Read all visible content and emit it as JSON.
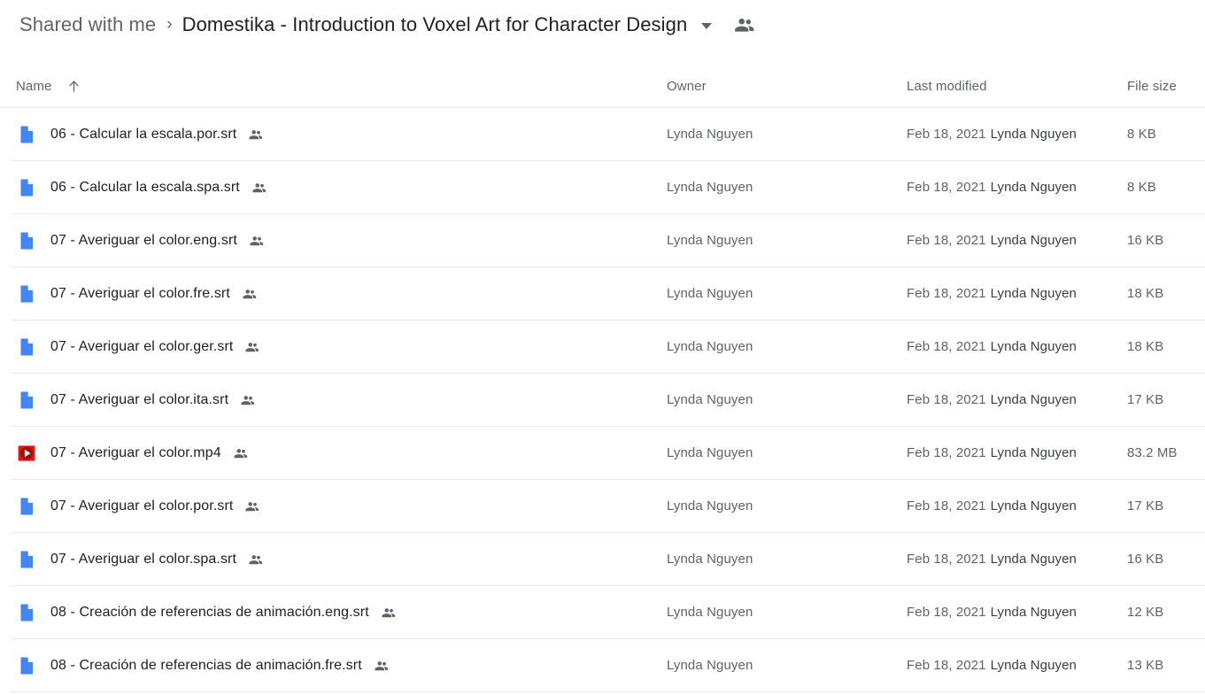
{
  "breadcrumb": {
    "parent": "Shared with me",
    "separator": "›",
    "current": "Domestika - Introduction to Voxel Art for Character Design",
    "caret_icon": "chevron-down-icon",
    "people_icon": "people-icon"
  },
  "columns": {
    "name": "Name",
    "sort_icon": "arrow-up-icon",
    "owner": "Owner",
    "last_modified": "Last modified",
    "file_size": "File size"
  },
  "files": [
    {
      "icon": "file-document-icon",
      "name": "06 - Calcular la escala.por.srt",
      "shared_icon": "people-icon",
      "owner": "Lynda Nguyen",
      "modified_date": "Feb 18, 2021",
      "modified_by": "Lynda Nguyen",
      "size": "8 KB"
    },
    {
      "icon": "file-document-icon",
      "name": "06 - Calcular la escala.spa.srt",
      "shared_icon": "people-icon",
      "owner": "Lynda Nguyen",
      "modified_date": "Feb 18, 2021",
      "modified_by": "Lynda Nguyen",
      "size": "8 KB"
    },
    {
      "icon": "file-document-icon",
      "name": "07 - Averiguar el color.eng.srt",
      "shared_icon": "people-icon",
      "owner": "Lynda Nguyen",
      "modified_date": "Feb 18, 2021",
      "modified_by": "Lynda Nguyen",
      "size": "16 KB"
    },
    {
      "icon": "file-document-icon",
      "name": "07 - Averiguar el color.fre.srt",
      "shared_icon": "people-icon",
      "owner": "Lynda Nguyen",
      "modified_date": "Feb 18, 2021",
      "modified_by": "Lynda Nguyen",
      "size": "18 KB"
    },
    {
      "icon": "file-document-icon",
      "name": "07 - Averiguar el color.ger.srt",
      "shared_icon": "people-icon",
      "owner": "Lynda Nguyen",
      "modified_date": "Feb 18, 2021",
      "modified_by": "Lynda Nguyen",
      "size": "18 KB"
    },
    {
      "icon": "file-document-icon",
      "name": "07 - Averiguar el color.ita.srt",
      "shared_icon": "people-icon",
      "owner": "Lynda Nguyen",
      "modified_date": "Feb 18, 2021",
      "modified_by": "Lynda Nguyen",
      "size": "17 KB"
    },
    {
      "icon": "file-video-icon",
      "name": "07 - Averiguar el color.mp4",
      "shared_icon": "people-icon",
      "owner": "Lynda Nguyen",
      "modified_date": "Feb 18, 2021",
      "modified_by": "Lynda Nguyen",
      "size": "83.2 MB"
    },
    {
      "icon": "file-document-icon",
      "name": "07 - Averiguar el color.por.srt",
      "shared_icon": "people-icon",
      "owner": "Lynda Nguyen",
      "modified_date": "Feb 18, 2021",
      "modified_by": "Lynda Nguyen",
      "size": "17 KB"
    },
    {
      "icon": "file-document-icon",
      "name": "07 - Averiguar el color.spa.srt",
      "shared_icon": "people-icon",
      "owner": "Lynda Nguyen",
      "modified_date": "Feb 18, 2021",
      "modified_by": "Lynda Nguyen",
      "size": "16 KB"
    },
    {
      "icon": "file-document-icon",
      "name": "08 - Creación de referencias de animación.eng.srt",
      "shared_icon": "people-icon",
      "owner": "Lynda Nguyen",
      "modified_date": "Feb 18, 2021",
      "modified_by": "Lynda Nguyen",
      "size": "12 KB"
    },
    {
      "icon": "file-document-icon",
      "name": "08 - Creación de referencias de animación.fre.srt",
      "shared_icon": "people-icon",
      "owner": "Lynda Nguyen",
      "modified_date": "Feb 18, 2021",
      "modified_by": "Lynda Nguyen",
      "size": "13 KB"
    }
  ],
  "colors": {
    "doc_blue": "#4285f4",
    "video_red": "#e8190c",
    "video_inner": "#9e1106",
    "text_primary": "#202124",
    "text_secondary": "#5f6368",
    "divider": "#e8eaed"
  }
}
